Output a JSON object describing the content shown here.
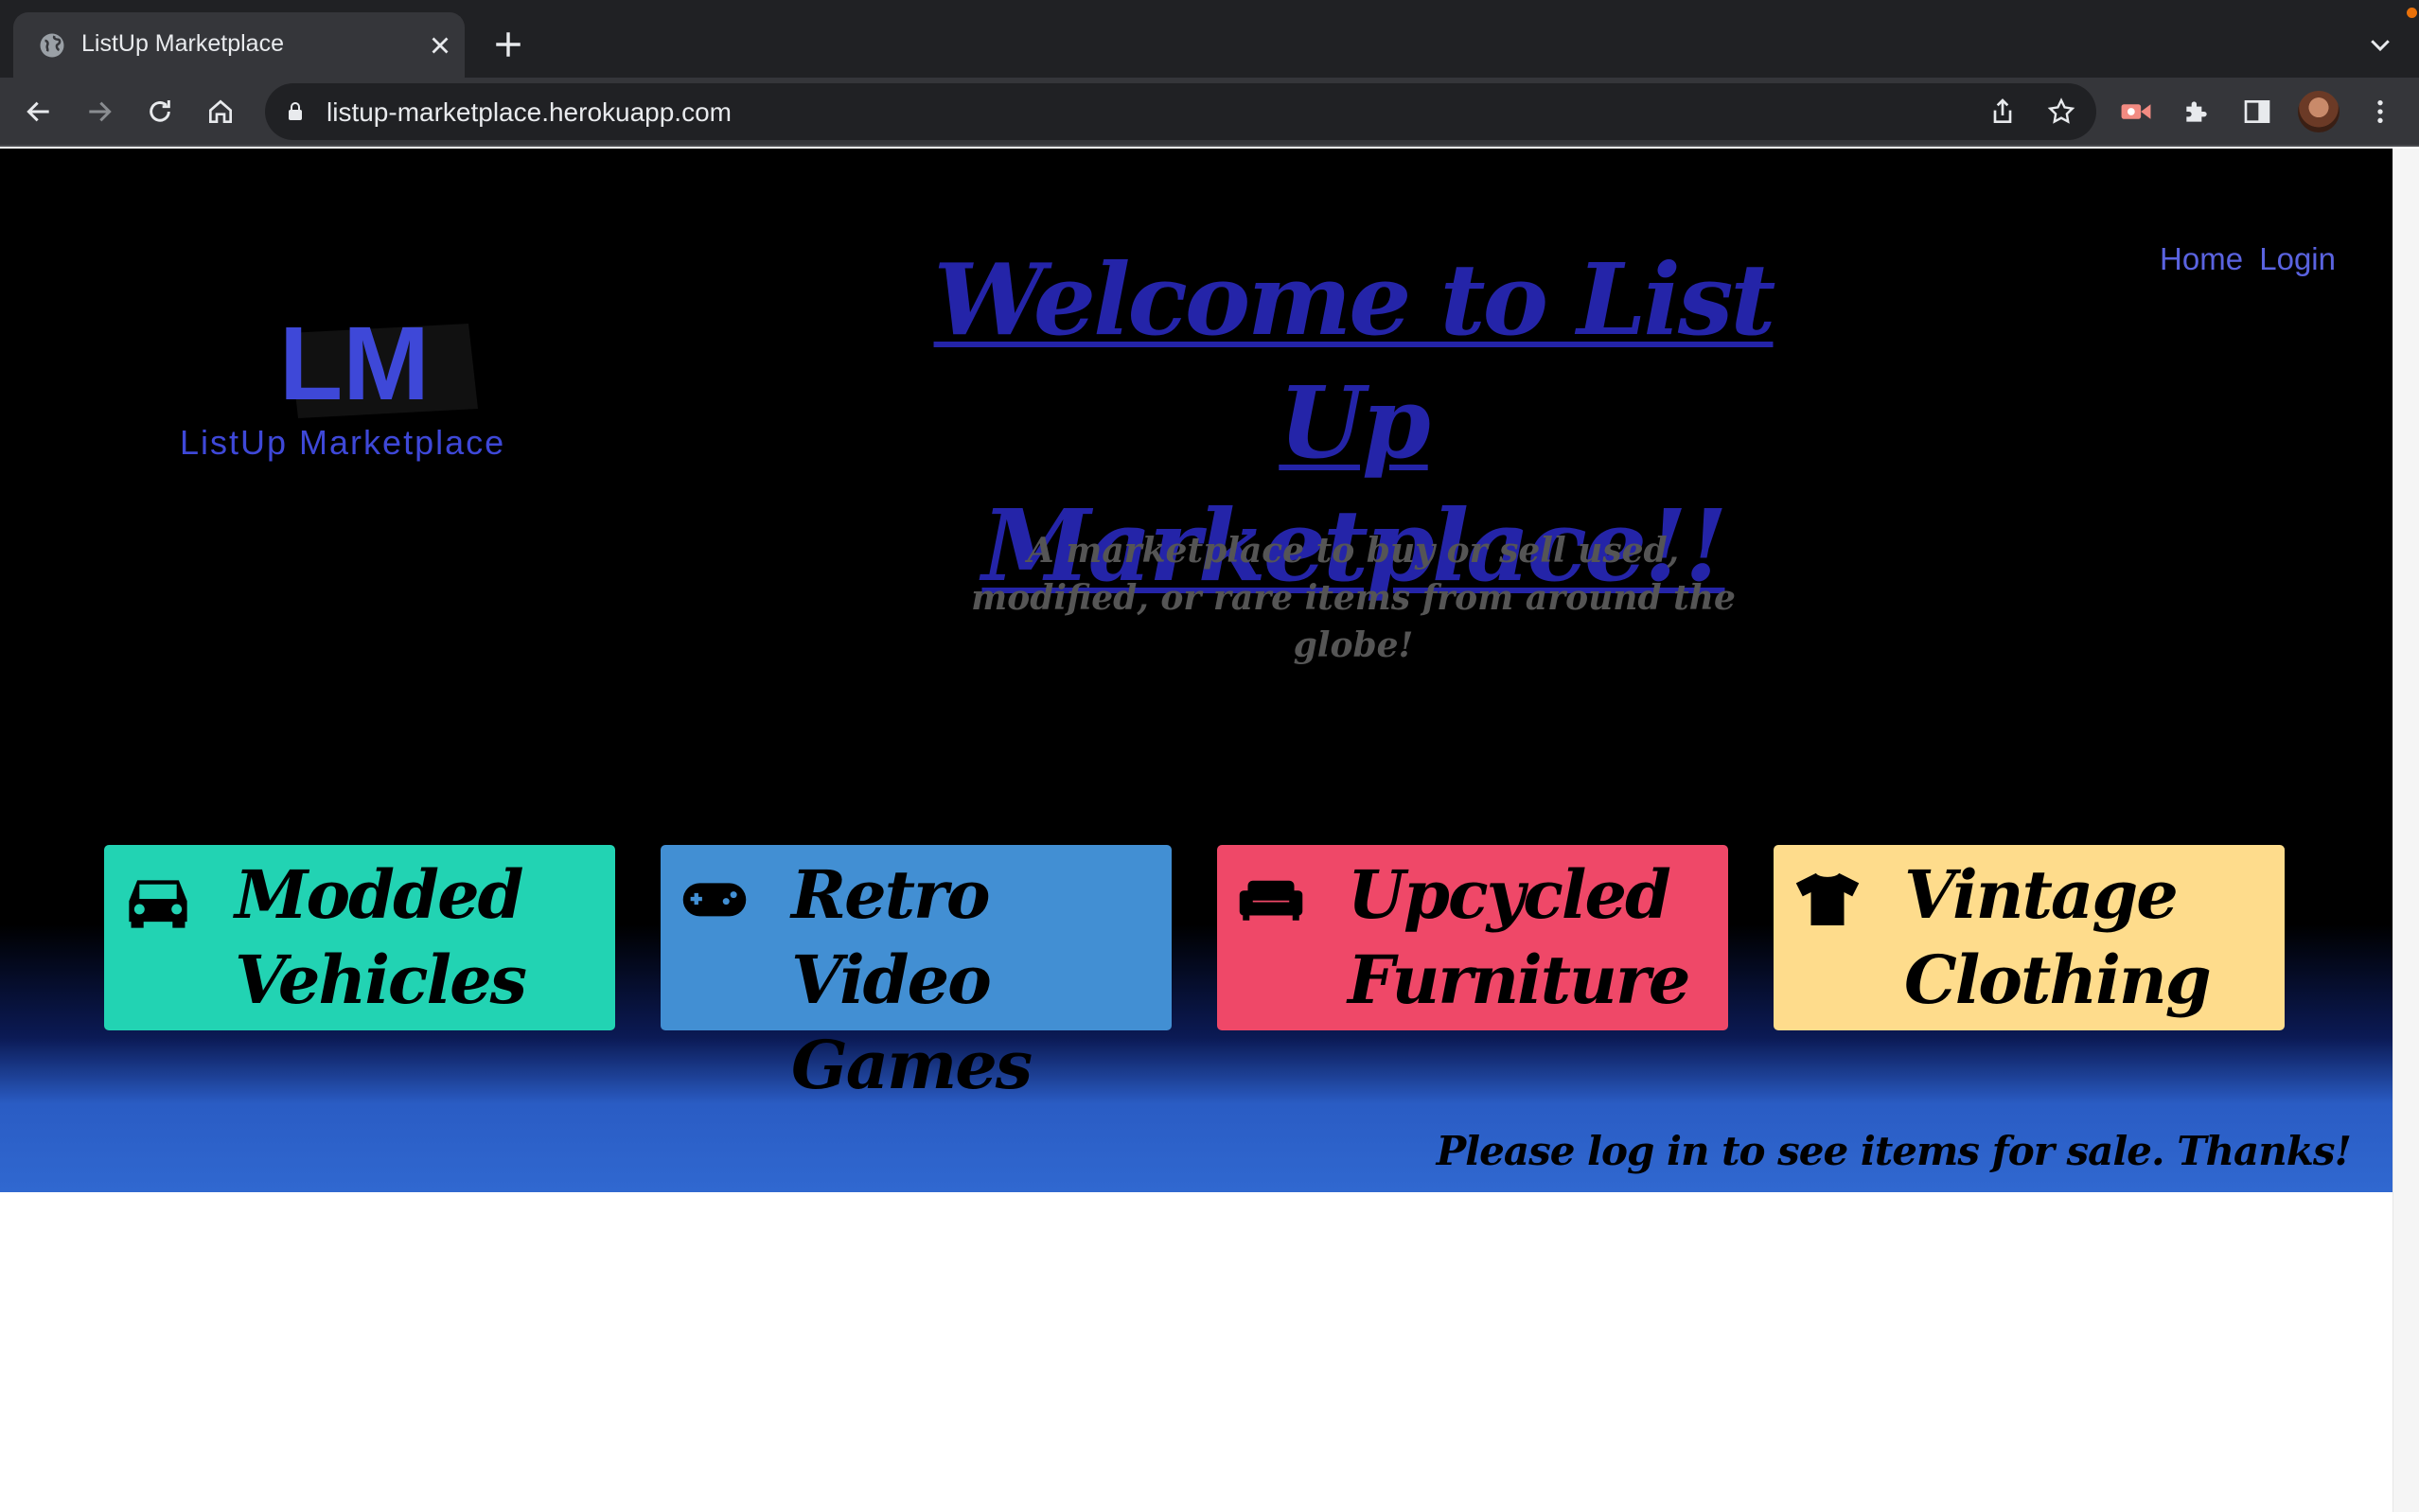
{
  "browser": {
    "tab_title": "ListUp Marketplace",
    "url": "listup-marketplace.herokuapp.com",
    "icons": [
      "globe-icon",
      "close-icon",
      "plus-icon",
      "chevron-down-icon",
      "back-icon",
      "forward-icon",
      "reload-icon",
      "home-icon",
      "lock-icon",
      "share-icon",
      "star-icon",
      "extension-icon",
      "puzzle-icon",
      "sidebar-icon",
      "more-icon"
    ]
  },
  "page": {
    "logo": {
      "text": "ListUp Marketplace",
      "letters": "LM"
    },
    "nav": {
      "home": "Home",
      "login": "Login"
    },
    "title": "Welcome to List Up Marketplace!!",
    "subtitle": "A marketplace to buy or sell used, modified, or rare items from around the globe!",
    "categories": [
      {
        "label": "Modded Vehicles",
        "icon": "car-icon",
        "color": "#22d3b3"
      },
      {
        "label": "Retro Video Games",
        "icon": "gamepad-icon",
        "color": "#428fd3"
      },
      {
        "label": "Upcycled Furniture",
        "icon": "couch-icon",
        "color": "#ef4868"
      },
      {
        "label": "Vintage Clothing",
        "icon": "tshirt-icon",
        "color": "#fedc8c"
      }
    ],
    "login_prompt": "Please log in to see items for sale. Thanks!"
  },
  "colors": {
    "title": "#2424a8",
    "nav_link": "#5a63e0",
    "hero_bottom": "#3068d0"
  }
}
